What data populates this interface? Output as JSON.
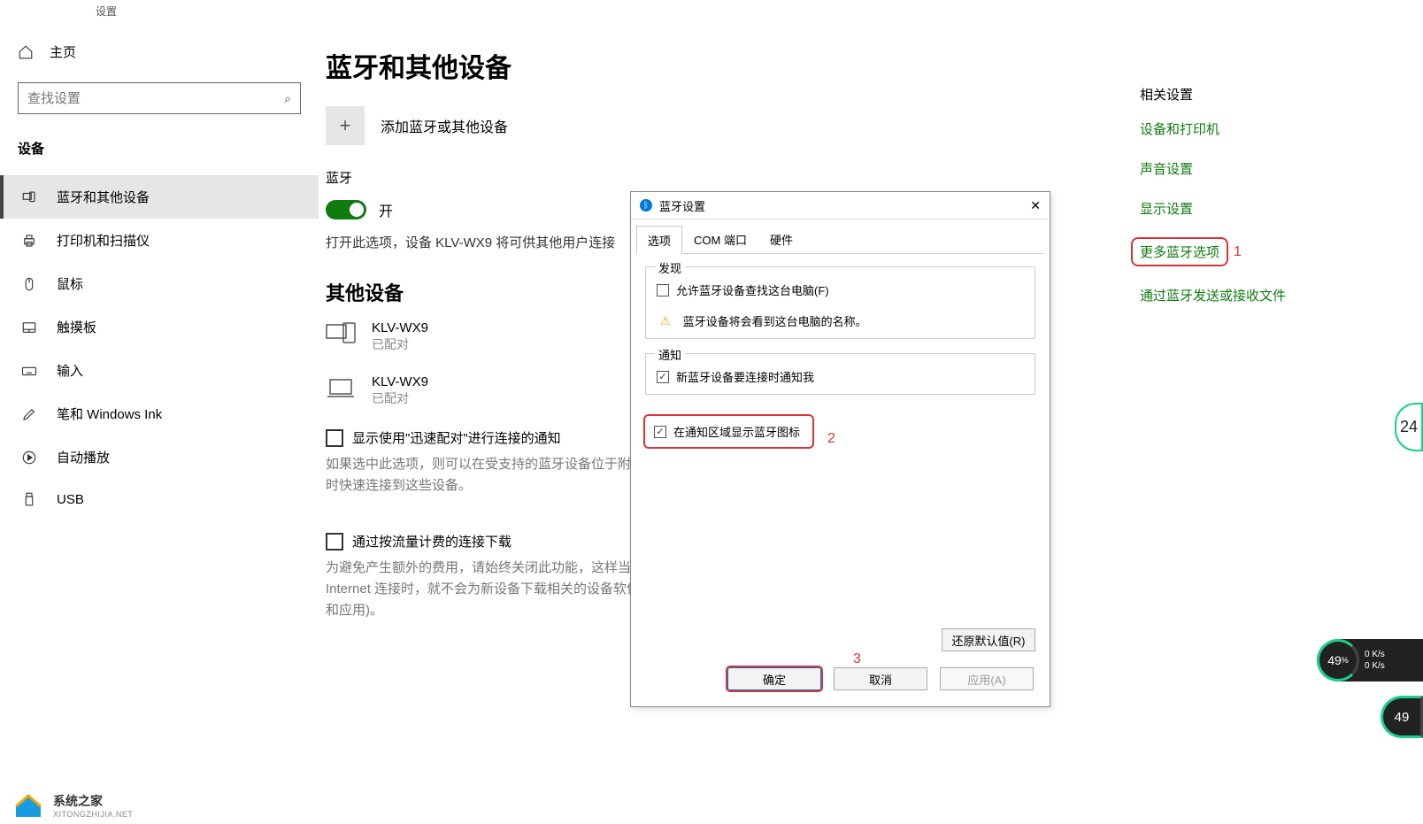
{
  "titlebar": "设置",
  "sidebar": {
    "home": "主页",
    "search_placeholder": "查找设置",
    "section": "设备",
    "items": [
      {
        "label": "蓝牙和其他设备"
      },
      {
        "label": "打印机和扫描仪"
      },
      {
        "label": "鼠标"
      },
      {
        "label": "触摸板"
      },
      {
        "label": "输入"
      },
      {
        "label": "笔和 Windows Ink"
      },
      {
        "label": "自动播放"
      },
      {
        "label": "USB"
      }
    ]
  },
  "main": {
    "title": "蓝牙和其他设备",
    "add_device": "添加蓝牙或其他设备",
    "bluetooth_heading": "蓝牙",
    "toggle_state": "开",
    "bt_help": "打开此选项，设备 KLV-WX9 将可供其他用户连接",
    "other_devices_heading": "其他设备",
    "devices": [
      {
        "name": "KLV-WX9",
        "status": "已配对"
      },
      {
        "name": "KLV-WX9",
        "status": "已配对"
      }
    ],
    "quickpair_label": "显示使用\"迅速配对\"进行连接的通知",
    "quickpair_desc": "如果选中此选项，则可以在受支持的蓝牙设备位于附近时快速连接到这些设备。",
    "metered_label": "通过按流量计费的连接下载",
    "metered_desc": "为避免产生额外的费用，请始终关闭此功能，这样当 Internet 连接时，就不会为新设备下载相关的设备软件和应用)。"
  },
  "right": {
    "heading": "相关设置",
    "links": [
      "设备和打印机",
      "声音设置",
      "显示设置",
      "更多蓝牙选项",
      "通过蓝牙发送或接收文件"
    ],
    "annot1": "1"
  },
  "dialog": {
    "title": "蓝牙设置",
    "tabs": [
      "选项",
      "COM 端口",
      "硬件"
    ],
    "group_discover": "发现",
    "chk_allow_find": "允许蓝牙设备查找这台电脑(F)",
    "warn_text": "蓝牙设备将会看到这台电脑的名称。",
    "group_notify": "通知",
    "chk_notify_connect": "新蓝牙设备要连接时通知我",
    "chk_show_icon": "在通知区域显示蓝牙图标",
    "annot2": "2",
    "annot3": "3",
    "btn_restore": "还原默认值(R)",
    "btn_ok": "确定",
    "btn_cancel": "取消",
    "btn_apply": "应用(A)"
  },
  "watermark": {
    "text": "系统之家",
    "sub": "XITONGZHIJIA.NET"
  },
  "widgets": {
    "clock": "24",
    "battery": "49",
    "battery_pct": "%",
    "up": "0 K/s",
    "down": "0 K/s",
    "net": "49"
  }
}
